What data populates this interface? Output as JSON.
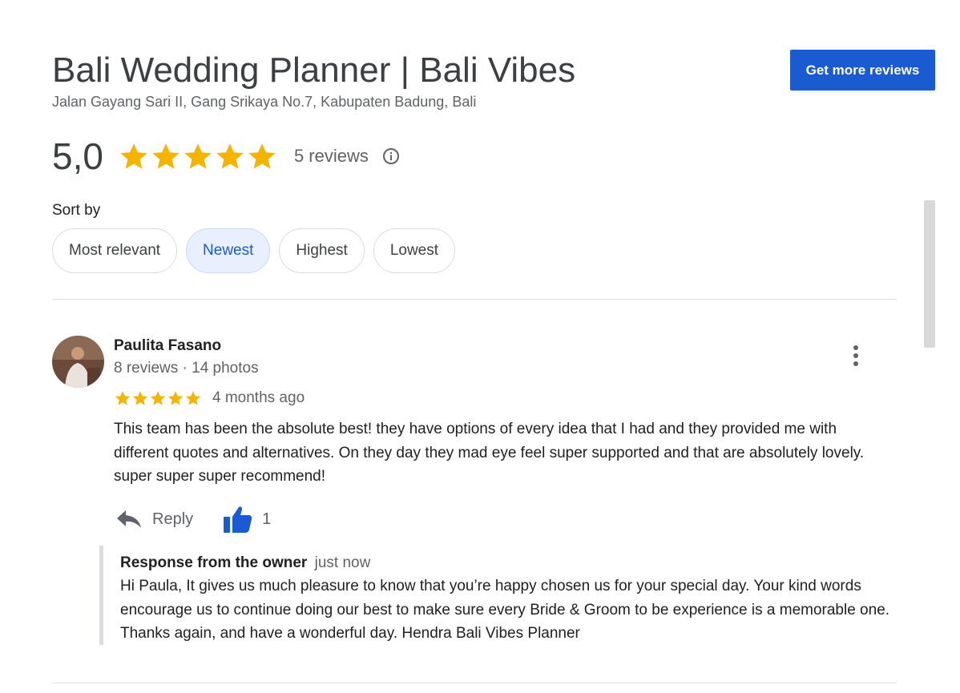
{
  "business": {
    "name": "Bali Wedding Planner | Bali Vibes",
    "address": "Jalan Gayang Sari II, Gang Srikaya No.7, Kabupaten Badung, Bali"
  },
  "header": {
    "get_reviews_label": "Get more reviews",
    "accent_color": "#1a5bd1"
  },
  "rating": {
    "value": "5,0",
    "stars": 5,
    "count_label": "5 reviews",
    "star_color": "#f4b400"
  },
  "sort": {
    "label": "Sort by",
    "options": [
      {
        "label": "Most relevant",
        "selected": false
      },
      {
        "label": "Newest",
        "selected": true
      },
      {
        "label": "Highest",
        "selected": false
      },
      {
        "label": "Lowest",
        "selected": false
      }
    ]
  },
  "reviews": [
    {
      "name": "Paulita Fasano",
      "meta": "8 reviews · 14 photos",
      "stars": 5,
      "time": "4 months ago",
      "text": "This team has been the absolute best! they have options of every idea that I had and they provided me with different quotes and alternatives. On they day they mad eye feel super supported and that are absolutely lovely. super super super recommend!",
      "reply_label": "Reply",
      "likes": "1",
      "owner_response": {
        "title": "Response from the owner",
        "time": "just now",
        "text": "Hi Paula, It gives us much pleasure to know that you’re happy chosen us for your special day. Your kind words encourage us to continue doing our best to make sure every Bride & Groom to be experience is a memorable one. Thanks again, and have a wonderful day. Hendra Bali Vibes Planner"
      }
    }
  ],
  "icons": {
    "star": "star-icon",
    "info": "info-icon",
    "more": "more-vert-icon",
    "reply": "reply-arrow-icon",
    "like": "thumbs-up-icon"
  }
}
